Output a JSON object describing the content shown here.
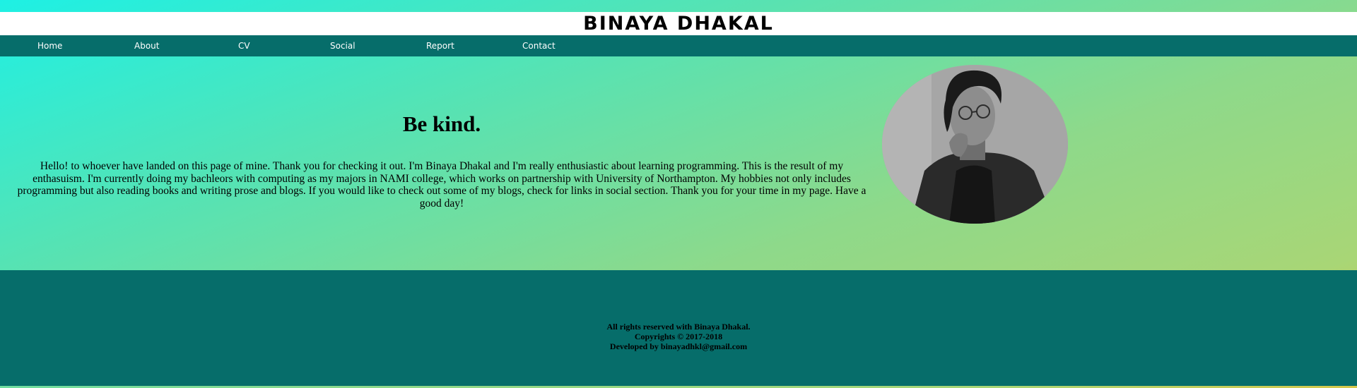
{
  "header": {
    "title": "BINAYA DHAKAL"
  },
  "nav": {
    "items": [
      {
        "label": "Home"
      },
      {
        "label": "About"
      },
      {
        "label": "CV"
      },
      {
        "label": "Social"
      },
      {
        "label": "Report"
      },
      {
        "label": "Contact"
      }
    ]
  },
  "main": {
    "heading": "Be kind.",
    "intro": "Hello! to whoever have landed on this page of mine. Thank you for checking it out. I'm Binaya Dhakal and I'm really enthusiastic about learning programming. This is the result of my enthasuism. I'm currently doing my bachleors with computing as my majors in NAMI college, which works on partnership with University of Northampton. My hobbies not only includes programming but also reading books and writing prose and blogs. If you would like to check out some of my blogs, check for links in social section. Thank you for your time in my page. Have a good day!"
  },
  "footer": {
    "line1": "All rights reserved with Binaya Dhakal.",
    "line2": "Copyrights © 2017-2018",
    "line3": "Developed by binayadhkl@gmail.com"
  },
  "colors": {
    "nav_background": "#066d6a",
    "footer_background": "#066d6a",
    "nav_text": "#ffffff",
    "gradient_start": "#1ef0e4",
    "gradient_end": "#d6c84a"
  }
}
